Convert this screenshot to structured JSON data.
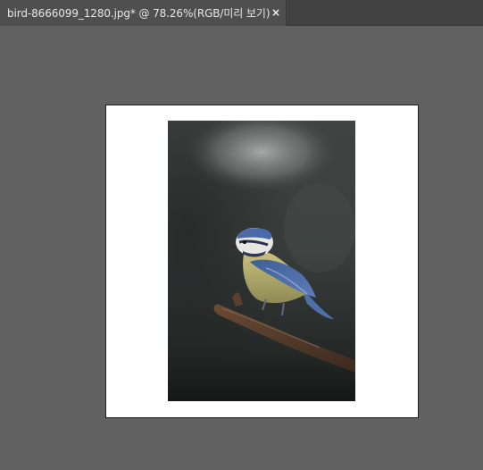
{
  "tab": {
    "title": "bird-8666099_1280.jpg* @ 78.26%(RGB/미리 보기)",
    "close_glyph": "×",
    "close_icon": "close-icon"
  },
  "document": {
    "image_subject": "blue tit perched on branch",
    "background_color": "#ffffff"
  },
  "colors": {
    "workspace": "#616161",
    "tabbar": "#424242",
    "active_tab": "#4f4f4f"
  }
}
